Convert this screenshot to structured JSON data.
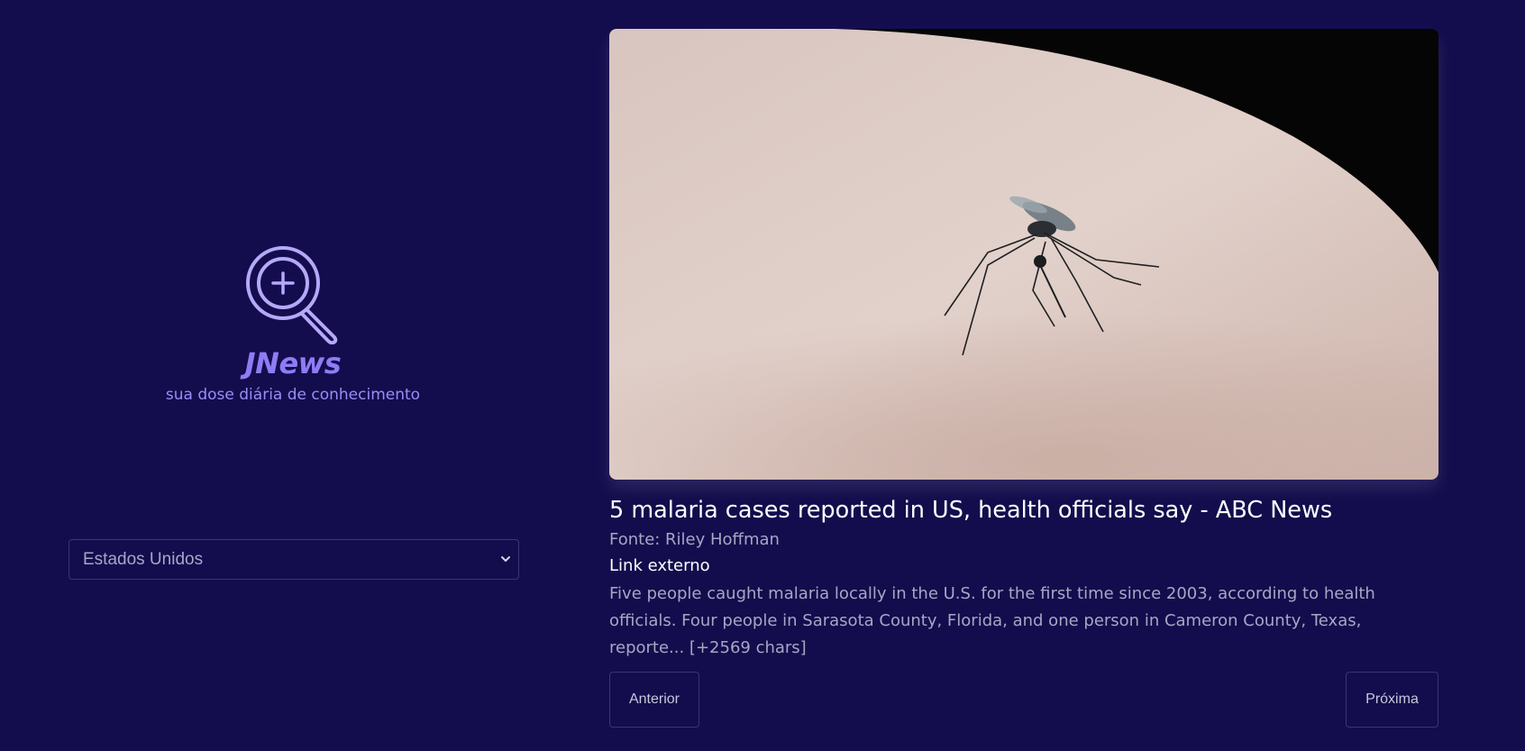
{
  "brand": {
    "logo_icon": "search-plus-icon",
    "title": "JNews",
    "subtitle": "sua dose diária de conhecimento",
    "accent_color": "#8f7cf4"
  },
  "filters": {
    "country_selected": "Estados Unidos"
  },
  "article": {
    "image_alt": "mosquito on skin",
    "title": "5 malaria cases reported in US, health officials say - ABC News",
    "source": "Fonte: Riley Hoffman",
    "link_label": "Link externo",
    "description": "Five people caught malaria locally in the U.S. for the first time since 2003, according to health officials. Four people in Sarasota County, Florida, and one person in Cameron County, Texas, reporte... [+2569 chars]"
  },
  "pagination": {
    "prev_label": "Anterior",
    "next_label": "Próxima"
  },
  "colors": {
    "background": "#130d4d",
    "border": "#3b3575"
  }
}
